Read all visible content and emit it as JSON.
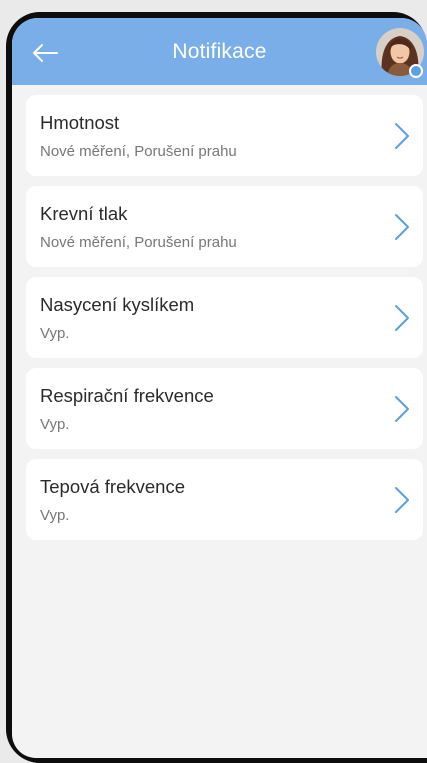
{
  "header": {
    "title": "Notifikace",
    "back_icon": "arrow-left-icon",
    "avatar_icon": "user-avatar-photo"
  },
  "colors": {
    "appbar": "#79aee8",
    "chevron": "#5b9fe3",
    "background": "#f3f3f3"
  },
  "items": [
    {
      "title": "Hmotnost",
      "subtitle": "Nové měření, Porušení prahu"
    },
    {
      "title": "Krevní tlak",
      "subtitle": "Nové měření, Porušení prahu"
    },
    {
      "title": "Nasycení kyslíkem",
      "subtitle": "Vyp."
    },
    {
      "title": "Respirační frekvence",
      "subtitle": "Vyp."
    },
    {
      "title": "Tepová frekvence",
      "subtitle": "Vyp."
    }
  ]
}
